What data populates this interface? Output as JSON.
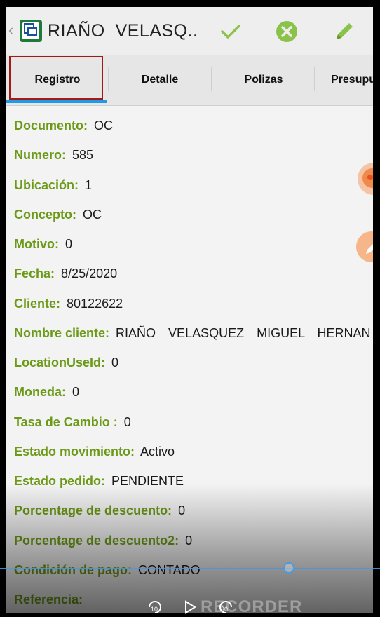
{
  "header": {
    "title": "RIAÑO  VELASQ..",
    "back_icon": "chevron-left-icon",
    "app_icon": "app-logo-icon",
    "actions": [
      {
        "name": "confirm",
        "icon": "check-icon",
        "color": "#8bc34a"
      },
      {
        "name": "cancel",
        "icon": "close-circle-icon",
        "color": "#8bc34a"
      },
      {
        "name": "edit",
        "icon": "pencil-icon",
        "color": "#8bc34a"
      }
    ]
  },
  "tabs": [
    {
      "label": "Registro",
      "active": true
    },
    {
      "label": "Detalle",
      "active": false
    },
    {
      "label": "Polizas",
      "active": false
    },
    {
      "label": "Presupu",
      "active": false
    }
  ],
  "colors": {
    "label_green": "#6b9a17",
    "tab_indicator": "#1d9be6",
    "focus_border": "#a31818",
    "fab_orange": "#f08a4b"
  },
  "fields": [
    {
      "label": "Documento:",
      "value": "OC"
    },
    {
      "label": "Numero:",
      "value": "585"
    },
    {
      "label": "Ubicación:",
      "value": "1"
    },
    {
      "label": "Concepto:",
      "value": "OC"
    },
    {
      "label": "Motivo:",
      "value": "0"
    },
    {
      "label": "Fecha:",
      "value": "8/25/2020"
    },
    {
      "label": "Cliente:",
      "value": "80122622"
    },
    {
      "label": "Nombre cliente:",
      "value": "RIAÑO  VELASQUEZ  MIGUEL  HERNAN"
    },
    {
      "label": "LocationUseId:",
      "value": "0"
    },
    {
      "label": "Moneda:",
      "value": "0"
    },
    {
      "label": "Tasa de Cambio :",
      "value": "0"
    },
    {
      "label": "Estado movimiento:",
      "value": "Activo"
    },
    {
      "label": "Estado pedido:",
      "value": "PENDIENTE"
    },
    {
      "label": "Porcentage de descuento:",
      "value": "0"
    },
    {
      "label": "Porcentage de descuento2:",
      "value": "0"
    },
    {
      "label": "Condición de pago:",
      "value": "CONTADO"
    },
    {
      "label": "Referencia:",
      "value": ""
    }
  ],
  "player": {
    "rewind_label": "10",
    "forward_label": "30",
    "watermark": "RECORDER",
    "progress": 0.75
  }
}
